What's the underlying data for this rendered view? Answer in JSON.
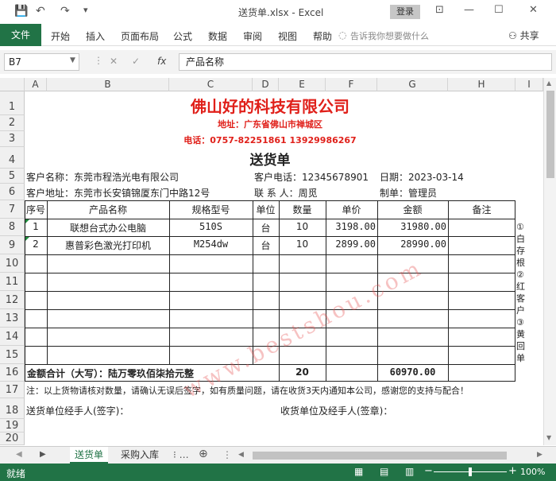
{
  "window": {
    "title": "送货单.xlsx  -  Excel",
    "login": "登录",
    "minimize": "—",
    "maximize": "☐",
    "close": "✕"
  },
  "ribbon": {
    "file": "文件",
    "tabs": [
      "开始",
      "插入",
      "页面布局",
      "公式",
      "数据",
      "审阅",
      "视图",
      "帮助"
    ],
    "tell_me": "告诉我你想要做什么",
    "share": "共享"
  },
  "formula_bar": {
    "name_box": "B7",
    "formula": "产品名称",
    "fx": "fx"
  },
  "columns": [
    "A",
    "B",
    "C",
    "D",
    "E",
    "F",
    "G",
    "H",
    "I"
  ],
  "rows": [
    "1",
    "2",
    "3",
    "4",
    "5",
    "6",
    "7",
    "8",
    "9",
    "10",
    "11",
    "12",
    "13",
    "14",
    "15",
    "16",
    "17",
    "18",
    "19",
    "20"
  ],
  "doc": {
    "company": "佛山好的科技有限公司",
    "address": "地址：广东省佛山市禅城区",
    "phone": "电话：0757-82251861  13929986267",
    "heading": "送货单",
    "customer_name": "客户名称：东莞市程浩光电有限公司",
    "customer_phone": "客户电话：12345678901",
    "date": "日期：2023-03-14",
    "customer_address": "客户地址：东莞市长安镇锦厦东门中路12号",
    "contact": "联 系 人：周觅",
    "maker": "制单：管理员",
    "headers": [
      "序号",
      "产品名称",
      "规格型号",
      "单位",
      "数量",
      "单价",
      "金额",
      "备注"
    ],
    "items": [
      {
        "no": "1",
        "name": "联想台式办公电脑",
        "spec": "510S",
        "unit": "台",
        "qty": "10",
        "price": "3198.00",
        "amount": "31980.00",
        "note": ""
      },
      {
        "no": "2",
        "name": "惠普彩色激光打印机",
        "spec": "M254dw",
        "unit": "台",
        "qty": "10",
        "price": "2899.00",
        "amount": "28990.00",
        "note": ""
      }
    ],
    "total_label": "金额合计（大写）：陆万零玖佰柒拾元整",
    "total_qty": "20",
    "total_amount": "60970.00",
    "side_note": "①白存根②红客户③黄回单",
    "notice": "注：以上货物请核对数量，请确认无误后签字，如有质量问题，请在收货3天内通知本公司，感谢您的支持与配合！",
    "sender": "送货单位经手人(签字)：",
    "receiver": "收货单位及经手人(签章)："
  },
  "watermark": "www.bestshou.com",
  "sheets": [
    "送货单",
    "采购入库"
  ],
  "status": {
    "ready": "就绪",
    "zoom": "100%"
  }
}
